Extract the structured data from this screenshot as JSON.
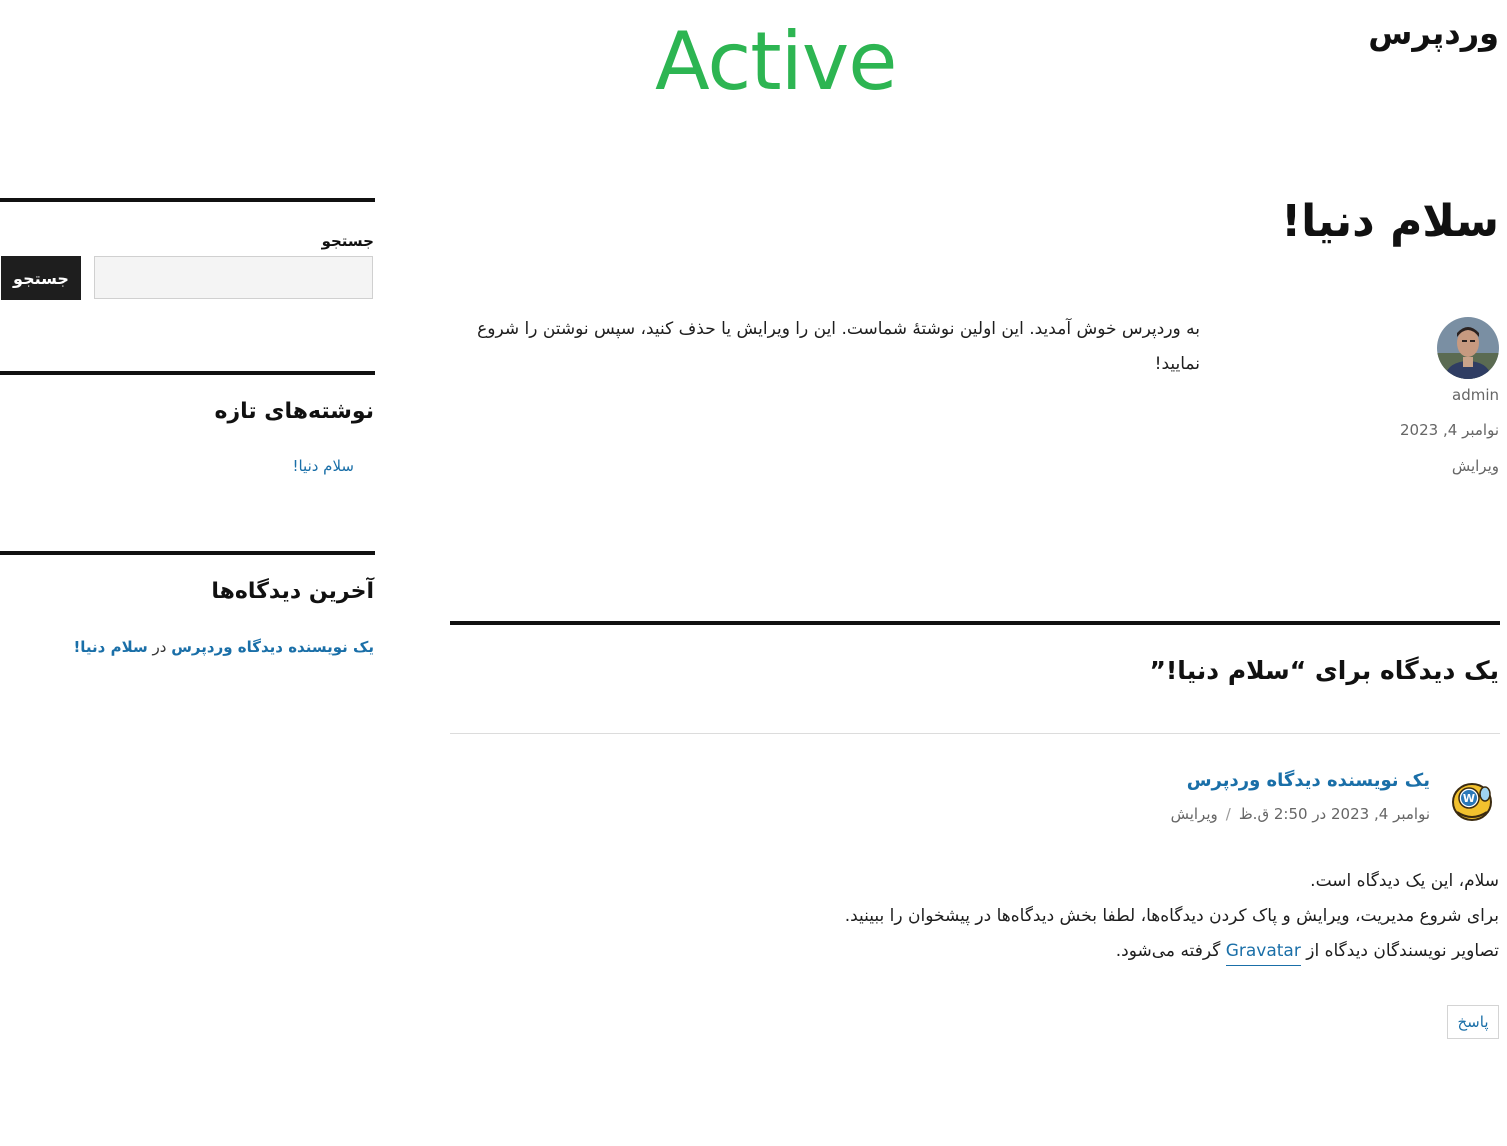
{
  "header": {
    "site_title": "وردپرس",
    "logo_text": "Active"
  },
  "post": {
    "title": "سلام دنیا!",
    "author": "admin",
    "date": "نوامبر 4, 2023",
    "edit": "ویرایش",
    "content": "به وردپرس خوش آمدید. این اولین نوشتهٔ شماست. این را ویرایش یا حذف کنید، سپس نوشتن را شروع نمایید!"
  },
  "comments": {
    "title": "یک دیدگاه برای “سلام دنیا!”",
    "author": "یک نویسنده دیدگاه وردپرس",
    "datetime": "نوامبر 4, 2023 در 2:50 ق.ظ",
    "separator": "/",
    "edit": "ویرایش",
    "line1": "سلام، این یک دیدگاه است.",
    "line2": "برای شروع مدیریت، ویرایش و پاک کردن دیدگاه‌ها، لطفا بخش دیدگاه‌ها در پیشخوان را ببینید.",
    "line3_before": "تصاویر نویسندگان دیدگاه از",
    "gravatar": "Gravatar",
    "line3_after": "گرفته می‌شود.",
    "reply": "پاسخ"
  },
  "sidebar": {
    "search_label": "جستجو",
    "search_value": "",
    "search_button": "جستجو",
    "recent_posts_title": "نوشته‌های تازه",
    "recent_post_1": "سلام دنیا!",
    "recent_comments_title": "آخرین دیدگاه‌ها",
    "recent_comment_author": "یک نویسنده دیدگاه وردپرس",
    "recent_comment_in": "در",
    "recent_comment_post": "سلام دنیا!"
  },
  "colors": {
    "logo": "#2db552",
    "link": "#1a6fa8",
    "button_bg": "#1e1e1e"
  }
}
